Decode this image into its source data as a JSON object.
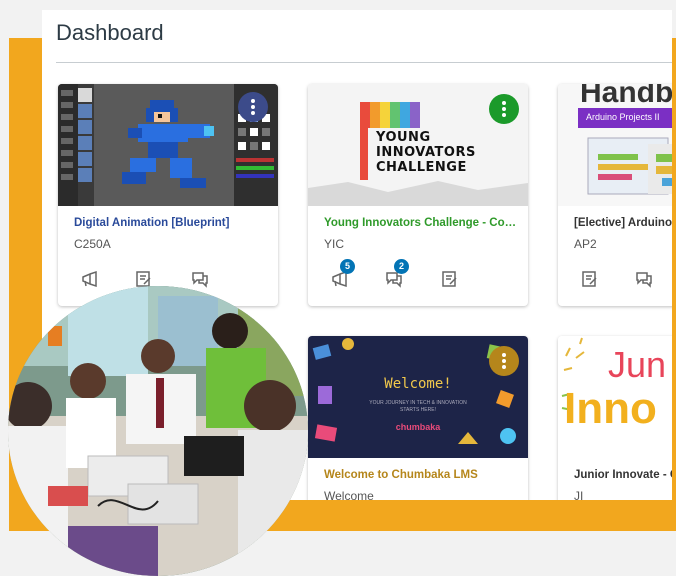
{
  "page": {
    "title": "Dashboard"
  },
  "cards": [
    {
      "title": "Digital Animation [Blueprint]",
      "code": "C250A",
      "title_color": "#2a4a9a",
      "accent": "#3c4b8a"
    },
    {
      "title": "Young Innovators Challenge - Com...",
      "code": "YIC",
      "title_color": "#2f9a2a",
      "accent": "#1b9a2a",
      "thumb_text": [
        "YOUNG",
        "INNOVATORS",
        "CHALLENGE"
      ],
      "badges": {
        "announcements": "5",
        "discussions": "2"
      }
    },
    {
      "title": "[Elective] Arduino Pr",
      "code": "AP2",
      "title_color": "#333333",
      "thumb_heading": "Handb",
      "thumb_banner": "Arduino Projects II"
    },
    {
      "title": "Welcome to Chumbaka LMS",
      "code": "Welcome",
      "title_color": "#b5861b",
      "accent": "#b5861b",
      "thumb_text": "Welcome!",
      "thumb_sub": "YOUR JOURNEY IN TECH & INNOVATION STARTS HERE!",
      "thumb_logo": "chumbaka"
    },
    {
      "title": "Junior Innovate - C",
      "code": "JI",
      "title_color": "#333333",
      "thumb_text": [
        "Jun",
        "Inno"
      ]
    }
  ],
  "icons": [
    "megaphone-icon",
    "assignment-icon",
    "discussion-icon"
  ]
}
